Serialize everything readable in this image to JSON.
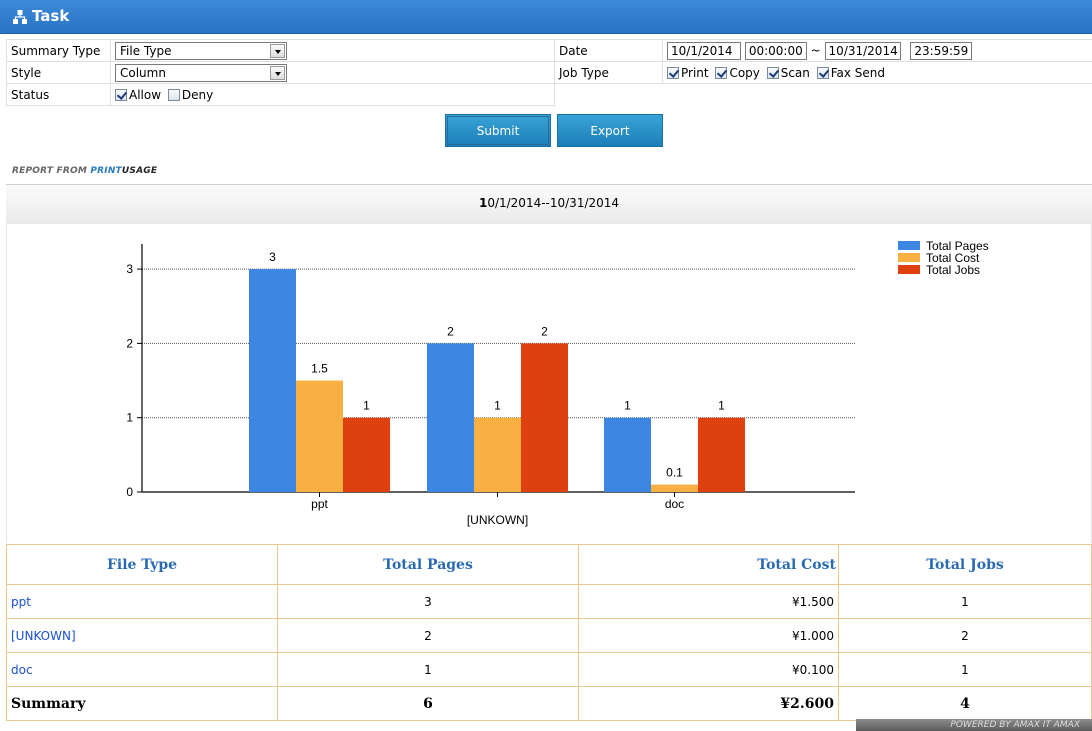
{
  "window": {
    "title": "Task"
  },
  "form": {
    "summary_type_label": "Summary Type",
    "summary_type_value": "File Type",
    "style_label": "Style",
    "style_value": "Column",
    "status_label": "Status",
    "status_allow": "Allow",
    "status_deny": "Deny",
    "date_label": "Date",
    "date_from": "10/1/2014",
    "time_from": "00:00:00",
    "date_sep": "~",
    "date_to": "10/31/2014",
    "time_to": "23:59:59",
    "job_type_label": "Job Type",
    "job_print": "Print",
    "job_copy": "Copy",
    "job_scan": "Scan",
    "job_fax": "Fax Send"
  },
  "buttons": {
    "submit": "Submit",
    "export": "Export"
  },
  "report": {
    "from_prefix": "REPORT FROM ",
    "brand_print": "PRINT",
    "brand_usage": "USAGE",
    "range_first": "1",
    "range_rest": "0/1/2014--10/31/2014"
  },
  "chart_data": {
    "type": "bar",
    "categories": [
      "ppt",
      "[UNKOWN]",
      "doc"
    ],
    "series": [
      {
        "name": "Total Pages",
        "values": [
          3,
          2,
          1
        ],
        "color": "#3d86e2"
      },
      {
        "name": "Total Cost",
        "values": [
          1.5,
          1,
          0.1
        ],
        "color": "#f9b042"
      },
      {
        "name": "Total Jobs",
        "values": [
          1,
          2,
          1
        ],
        "color": "#df4010"
      }
    ],
    "yticks": [
      0,
      1,
      2,
      3
    ],
    "ylim": [
      0,
      3.5
    ],
    "grid": true,
    "legend": "top-right"
  },
  "table": {
    "headers": [
      "File Type",
      "Total Pages",
      "Total Cost",
      "Total Jobs"
    ],
    "rows": [
      [
        "ppt",
        "3",
        "¥1.500",
        "1"
      ],
      [
        "[UNKOWN]",
        "2",
        "¥1.000",
        "2"
      ],
      [
        "doc",
        "1",
        "¥0.100",
        "1"
      ]
    ],
    "summary": [
      "Summary",
      "6",
      "¥2.600",
      "4"
    ]
  },
  "footer": {
    "text": "POWERED BY AMAX IT  AMAX"
  }
}
